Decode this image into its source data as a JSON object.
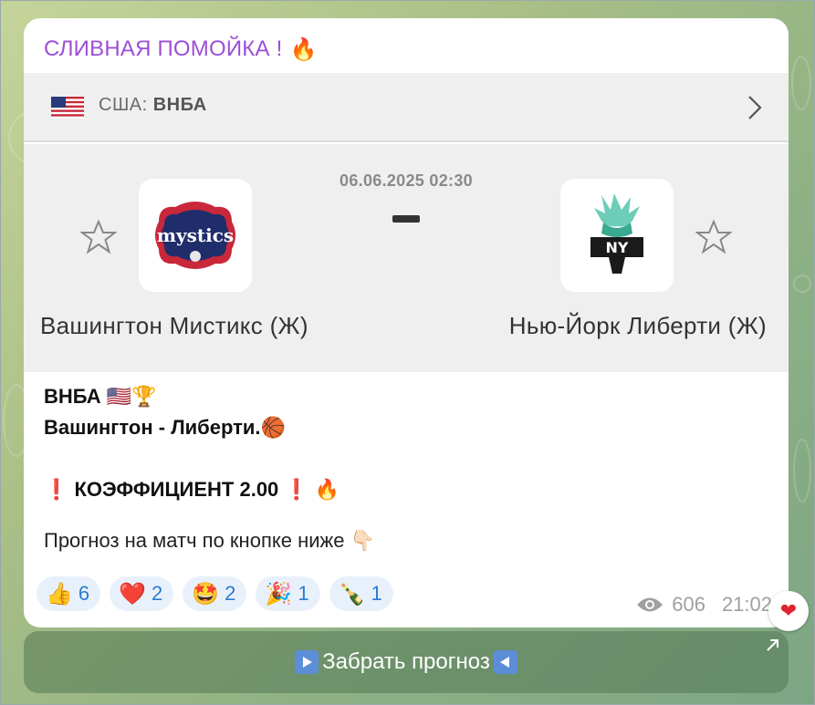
{
  "channel": {
    "title": "СЛИВНАЯ ПОМОЙКА !",
    "title_emoji": "🔥"
  },
  "league": {
    "country": "США:",
    "name": "ВНБА",
    "flag_icon": "us-flag-icon"
  },
  "match": {
    "datetime": "06.06.2025 02:30",
    "home_team": "Вашингтон Мистикс (Ж)",
    "away_team": "Нью-Йорк Либерти (Ж)",
    "home_logo_text": "mystics",
    "away_logo_text": "NY"
  },
  "message": {
    "line1": "ВНБА 🇺🇸🏆",
    "line2": "Вашингтон - Либерти.🏀",
    "line3": "❗ КОЭФФИЦИЕНТ 2.00 ❗ 🔥",
    "line4": "Прогноз на матч по кнопке ниже 👇🏻"
  },
  "reactions": [
    {
      "emoji": "👍",
      "count": "6"
    },
    {
      "emoji": "❤️",
      "count": "2"
    },
    {
      "emoji": "🤩",
      "count": "2"
    },
    {
      "emoji": "🎉",
      "count": "1"
    },
    {
      "emoji": "🍾",
      "count": "1"
    }
  ],
  "meta": {
    "views": "606",
    "time": "21:02"
  },
  "button": {
    "label": "Забрать прогноз"
  },
  "colors": {
    "title": "#9c4fd6",
    "reaction_bg": "#e8f1fb",
    "reaction_text": "#2b7bd1",
    "card_bg": "#efefef"
  }
}
